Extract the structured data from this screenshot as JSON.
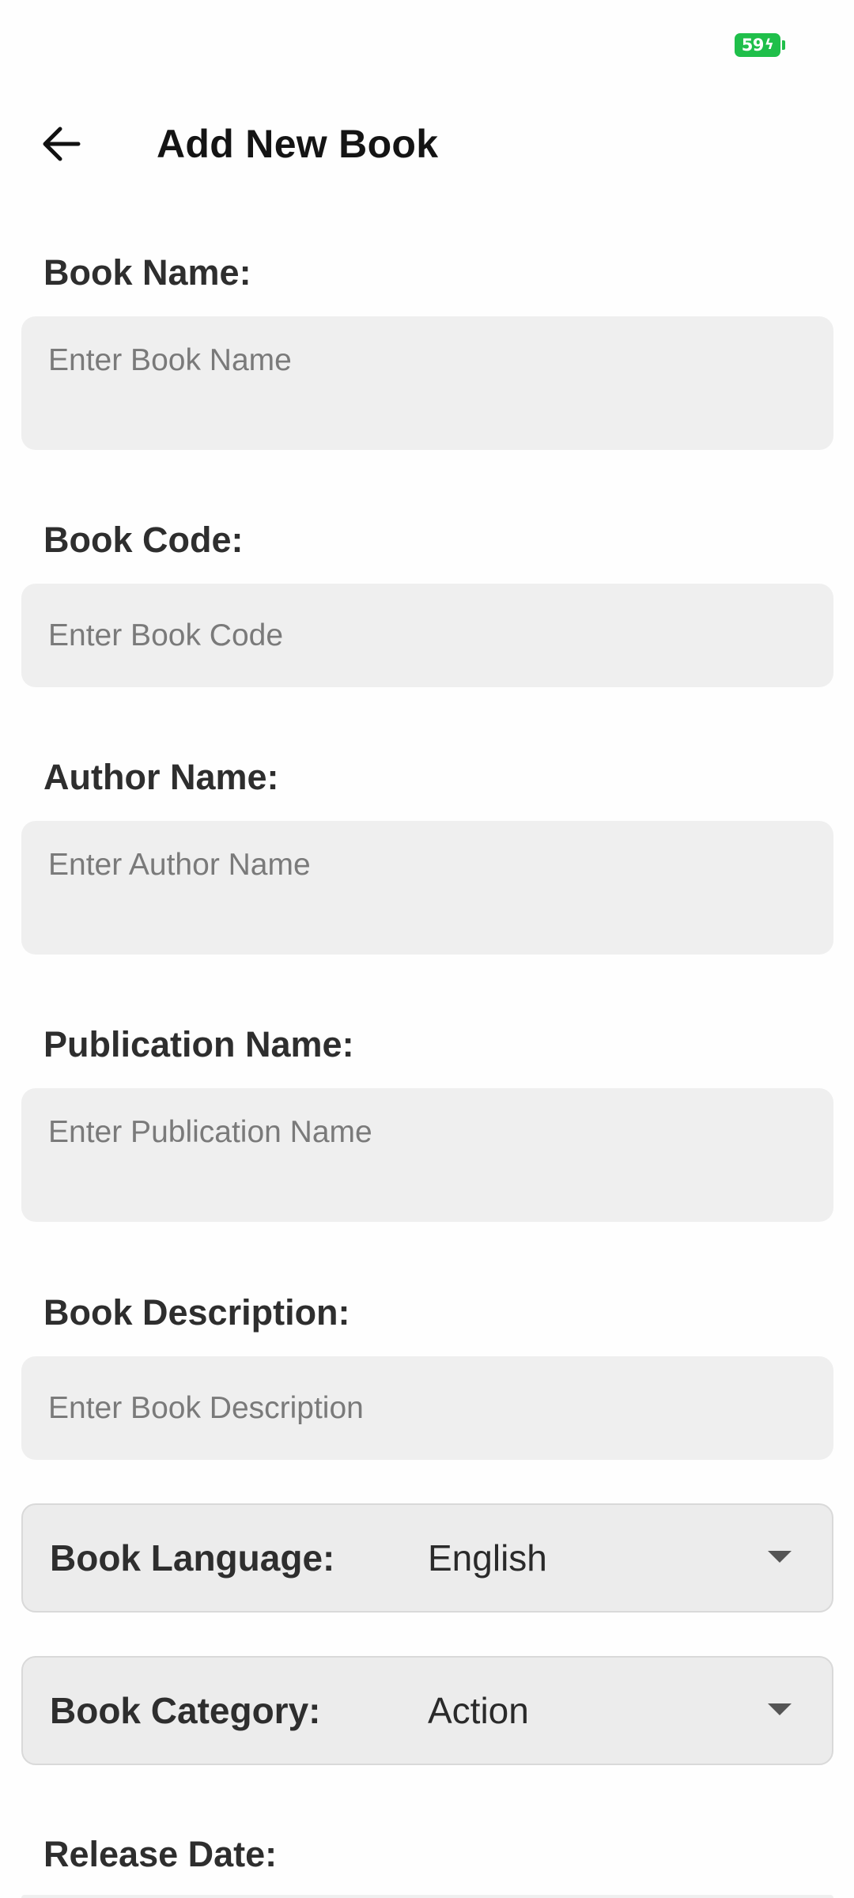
{
  "status_bar": {
    "battery_level": "59",
    "battery_color": "#1fbf4a"
  },
  "toolbar": {
    "title": "Add New Book"
  },
  "form": {
    "book_name": {
      "label": "Book Name:",
      "placeholder": "Enter Book Name",
      "value": ""
    },
    "book_code": {
      "label": "Book Code:",
      "placeholder": "Enter Book Code",
      "value": ""
    },
    "author_name": {
      "label": "Author Name:",
      "placeholder": "Enter Author Name",
      "value": ""
    },
    "publication_name": {
      "label": "Publication Name:",
      "placeholder": "Enter Publication Name",
      "value": ""
    },
    "book_description": {
      "label": "Book Description:",
      "placeholder": "Enter Book Description",
      "value": ""
    },
    "book_language": {
      "label": "Book Language:",
      "selected": "English"
    },
    "book_category": {
      "label": "Book Category:",
      "selected": "Action"
    },
    "release_date": {
      "label": "Release Date:"
    }
  }
}
